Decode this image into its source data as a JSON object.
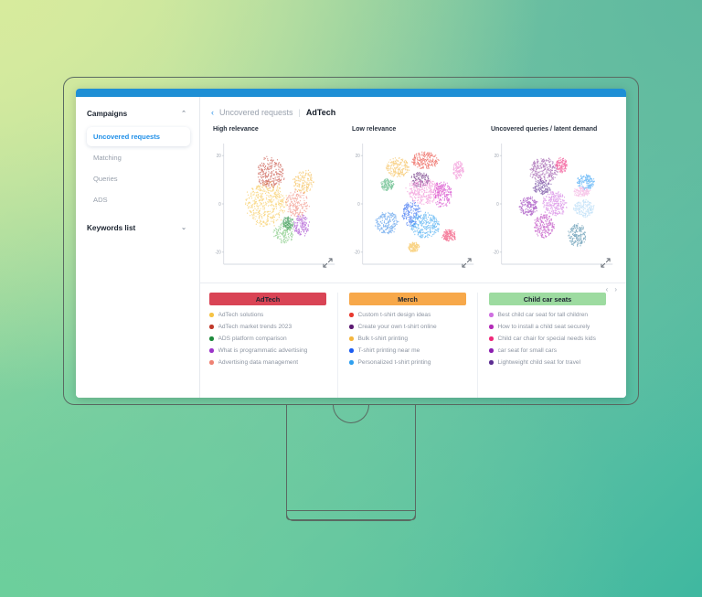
{
  "window": {
    "topbar_color": "#1e8fd5"
  },
  "sidebar": {
    "section_one": {
      "label": "Campaigns",
      "chevron": "⌃"
    },
    "items": [
      {
        "label": "Uncovered requests",
        "active": true
      },
      {
        "label": "Matching",
        "active": false
      },
      {
        "label": "Queries",
        "active": false
      },
      {
        "label": "ADS",
        "active": false
      }
    ],
    "section_two": {
      "label": "Keywords list",
      "chevron": "⌄"
    }
  },
  "breadcrumb": {
    "back_icon": "‹",
    "parent": "Uncovered requests",
    "separator": "|",
    "current": "AdTech"
  },
  "charts": [
    {
      "title": "High relevance",
      "yticks": [
        "20",
        "0",
        "-20"
      ],
      "expand_icon": "expand-icon"
    },
    {
      "title": "Low relevance",
      "yticks": [
        "20",
        "0",
        "-20"
      ],
      "expand_icon": "expand-icon"
    },
    {
      "title": "Uncovered queries / latent demand",
      "yticks": [
        "20",
        "0",
        "-20"
      ],
      "expand_icon": "expand-icon"
    }
  ],
  "legend": {
    "prev_icon": "‹",
    "next_icon": "›",
    "columns": [
      {
        "header": "AdTech",
        "header_bg": "#d94455",
        "rows": [
          {
            "color": "#f6c344",
            "text": "AdTech solutions"
          },
          {
            "color": "#c0392b",
            "text": "AdTech market trends 2023"
          },
          {
            "color": "#1e8a3c",
            "text": "ADS platform comparison"
          },
          {
            "color": "#9b34c9",
            "text": "What is programmatic advertising"
          },
          {
            "color": "#ef8273",
            "text": "Advertising data management"
          }
        ]
      },
      {
        "header": "Merch",
        "header_bg": "#f7a84a",
        "rows": [
          {
            "color": "#e8392e",
            "text": "Custom t-shirt design ideas"
          },
          {
            "color": "#5c1a72",
            "text": "Create your own t-shirt online"
          },
          {
            "color": "#f4b63f",
            "text": "Bulk t-shirt printing"
          },
          {
            "color": "#1c5cf0",
            "text": "T-shirt printing near me"
          },
          {
            "color": "#2fa0ef",
            "text": "Personalized t-shirt printing"
          }
        ]
      },
      {
        "header": "Child car seats",
        "header_bg": "#9ddba0",
        "rows": [
          {
            "color": "#cf6fe0",
            "text": "Best child car seat for tall children"
          },
          {
            "color": "#b32bb8",
            "text": "How to install a child seat securely"
          },
          {
            "color": "#ef2a7b",
            "text": "Child car chair for special needs kids"
          },
          {
            "color": "#8c1fb0",
            "text": "car seat for small cars"
          },
          {
            "color": "#5c2d91",
            "text": "Lightweight child seat for travel"
          }
        ]
      }
    ]
  },
  "chart_data": {
    "type": "scatter",
    "title": "Query embedding clusters (t-SNE / UMAP projections)",
    "xlabel": "",
    "ylabel": "",
    "ylim": [
      -25,
      25
    ],
    "xlim": [
      -25,
      25
    ],
    "grid": false,
    "legend_position": "below",
    "panels": [
      {
        "title": "High relevance",
        "yticks": [
          20,
          0,
          -20
        ],
        "clusters": [
          {
            "name": "AdTech solutions",
            "color": "#f6c344",
            "cx": -6,
            "cy": 0,
            "rx": 9,
            "ry": 9,
            "n": 2600
          },
          {
            "name": "AdTech market trends 2023",
            "color": "#c0392b",
            "cx": -4,
            "cy": 13,
            "rx": 6,
            "ry": 6,
            "n": 1500
          },
          {
            "name": "Gold cluster",
            "color": "#f4b63f",
            "cx": 11,
            "cy": 9,
            "rx": 4.5,
            "ry": 4.5,
            "n": 900
          },
          {
            "name": "Advertising data management",
            "color": "#ef8273",
            "cx": 8,
            "cy": 0,
            "rx": 5,
            "ry": 5.5,
            "n": 1100
          },
          {
            "name": "ADS platform comparison",
            "color": "#6bbf6b",
            "cx": 2,
            "cy": -12,
            "rx": 4.5,
            "ry": 4,
            "n": 900
          },
          {
            "name": "ADS dark green",
            "color": "#1e8a3c",
            "cx": 4,
            "cy": -8,
            "rx": 2.5,
            "ry": 2.5,
            "n": 400
          },
          {
            "name": "What is programmatic advertising",
            "color": "#9b34c9",
            "cx": 10,
            "cy": -9,
            "rx": 3.5,
            "ry": 4.5,
            "n": 800
          }
        ]
      },
      {
        "title": "Low relevance",
        "yticks": [
          20,
          0,
          -20
        ],
        "clusters": [
          {
            "name": "Custom t-shirt design ideas",
            "color": "#e8392e",
            "cx": 3,
            "cy": 18,
            "rx": 6,
            "ry": 3.5,
            "n": 1200
          },
          {
            "name": "Bulk t-shirt printing",
            "color": "#f4b63f",
            "cx": -9,
            "cy": 15,
            "rx": 5,
            "ry": 4,
            "n": 1100
          },
          {
            "name": "Green small",
            "color": "#3cab6b",
            "cx": -14,
            "cy": 8,
            "rx": 3,
            "ry": 2.5,
            "n": 500
          },
          {
            "name": "Create your own t-shirt online",
            "color": "#5c1a72",
            "cx": 1,
            "cy": 10,
            "rx": 4,
            "ry": 3,
            "n": 700
          },
          {
            "name": "Pink main",
            "color": "#ef7fd0",
            "cx": 3,
            "cy": 5,
            "rx": 8,
            "ry": 5,
            "n": 1900
          },
          {
            "name": "Magenta",
            "color": "#cf2ac4",
            "cx": 11,
            "cy": 4,
            "rx": 4,
            "ry": 5.5,
            "n": 1100
          },
          {
            "name": "T-shirt printing near me",
            "color": "#1c5cf0",
            "cx": -3,
            "cy": -4,
            "rx": 4,
            "ry": 5,
            "n": 1100
          },
          {
            "name": "Personalized t-shirt printing",
            "color": "#2fa0ef",
            "cx": 3,
            "cy": -9,
            "rx": 6.5,
            "ry": 5,
            "n": 1700
          },
          {
            "name": "Blue left",
            "color": "#3f8ee8",
            "cx": -14,
            "cy": -8,
            "rx": 5,
            "ry": 4.5,
            "n": 1200
          },
          {
            "name": "Pink right small",
            "color": "#ef7fd0",
            "cx": 18,
            "cy": 14,
            "rx": 2.5,
            "ry": 3.5,
            "n": 500
          },
          {
            "name": "Crimson right",
            "color": "#ef3060",
            "cx": 14,
            "cy": -13,
            "rx": 3,
            "ry": 2.5,
            "n": 500
          },
          {
            "name": "Gold bottom",
            "color": "#f6b93b",
            "cx": -2,
            "cy": -18,
            "rx": 2.5,
            "ry": 2,
            "n": 400
          }
        ]
      },
      {
        "title": "Uncovered queries / latent demand",
        "yticks": [
          20,
          0,
          -20
        ],
        "clusters": [
          {
            "name": "Purple top",
            "color": "#8e3f9e",
            "cx": -6,
            "cy": 14,
            "rx": 6,
            "ry": 5,
            "n": 1600
          },
          {
            "name": "Child car chair for special needs kids",
            "color": "#ef2a7b",
            "cx": 2,
            "cy": 16,
            "rx": 2.5,
            "ry": 3,
            "n": 500
          },
          {
            "name": "Lightweight child seat for travel",
            "color": "#5c2d91",
            "cx": -7,
            "cy": 7,
            "rx": 4,
            "ry": 3,
            "n": 800
          },
          {
            "name": "Best child car seat for tall children",
            "color": "#cf6fe0",
            "cx": -1,
            "cy": 0,
            "rx": 5.5,
            "ry": 5,
            "n": 1500
          },
          {
            "name": "car seat for small cars",
            "color": "#8c1fb0",
            "cx": -13,
            "cy": -1,
            "rx": 4,
            "ry": 4,
            "n": 1000
          },
          {
            "name": "How to install a child seat securely",
            "color": "#b32bb8",
            "cx": -6,
            "cy": -9,
            "rx": 4.5,
            "ry": 5,
            "n": 1200
          },
          {
            "name": "Bright blue",
            "color": "#2f9df4",
            "cx": 13,
            "cy": 9,
            "rx": 4,
            "ry": 3,
            "n": 900
          },
          {
            "name": "Light pink band",
            "color": "#f3a7dd",
            "cx": 11,
            "cy": 5,
            "rx": 3.5,
            "ry": 2,
            "n": 600
          },
          {
            "name": "Pale blue",
            "color": "#a8d5f5",
            "cx": 12,
            "cy": -2,
            "rx": 4.5,
            "ry": 3.5,
            "n": 1000
          },
          {
            "name": "Teal blue",
            "color": "#3a7fa0",
            "cx": 9,
            "cy": -13,
            "rx": 4,
            "ry": 4.5,
            "n": 1000
          }
        ]
      }
    ]
  }
}
